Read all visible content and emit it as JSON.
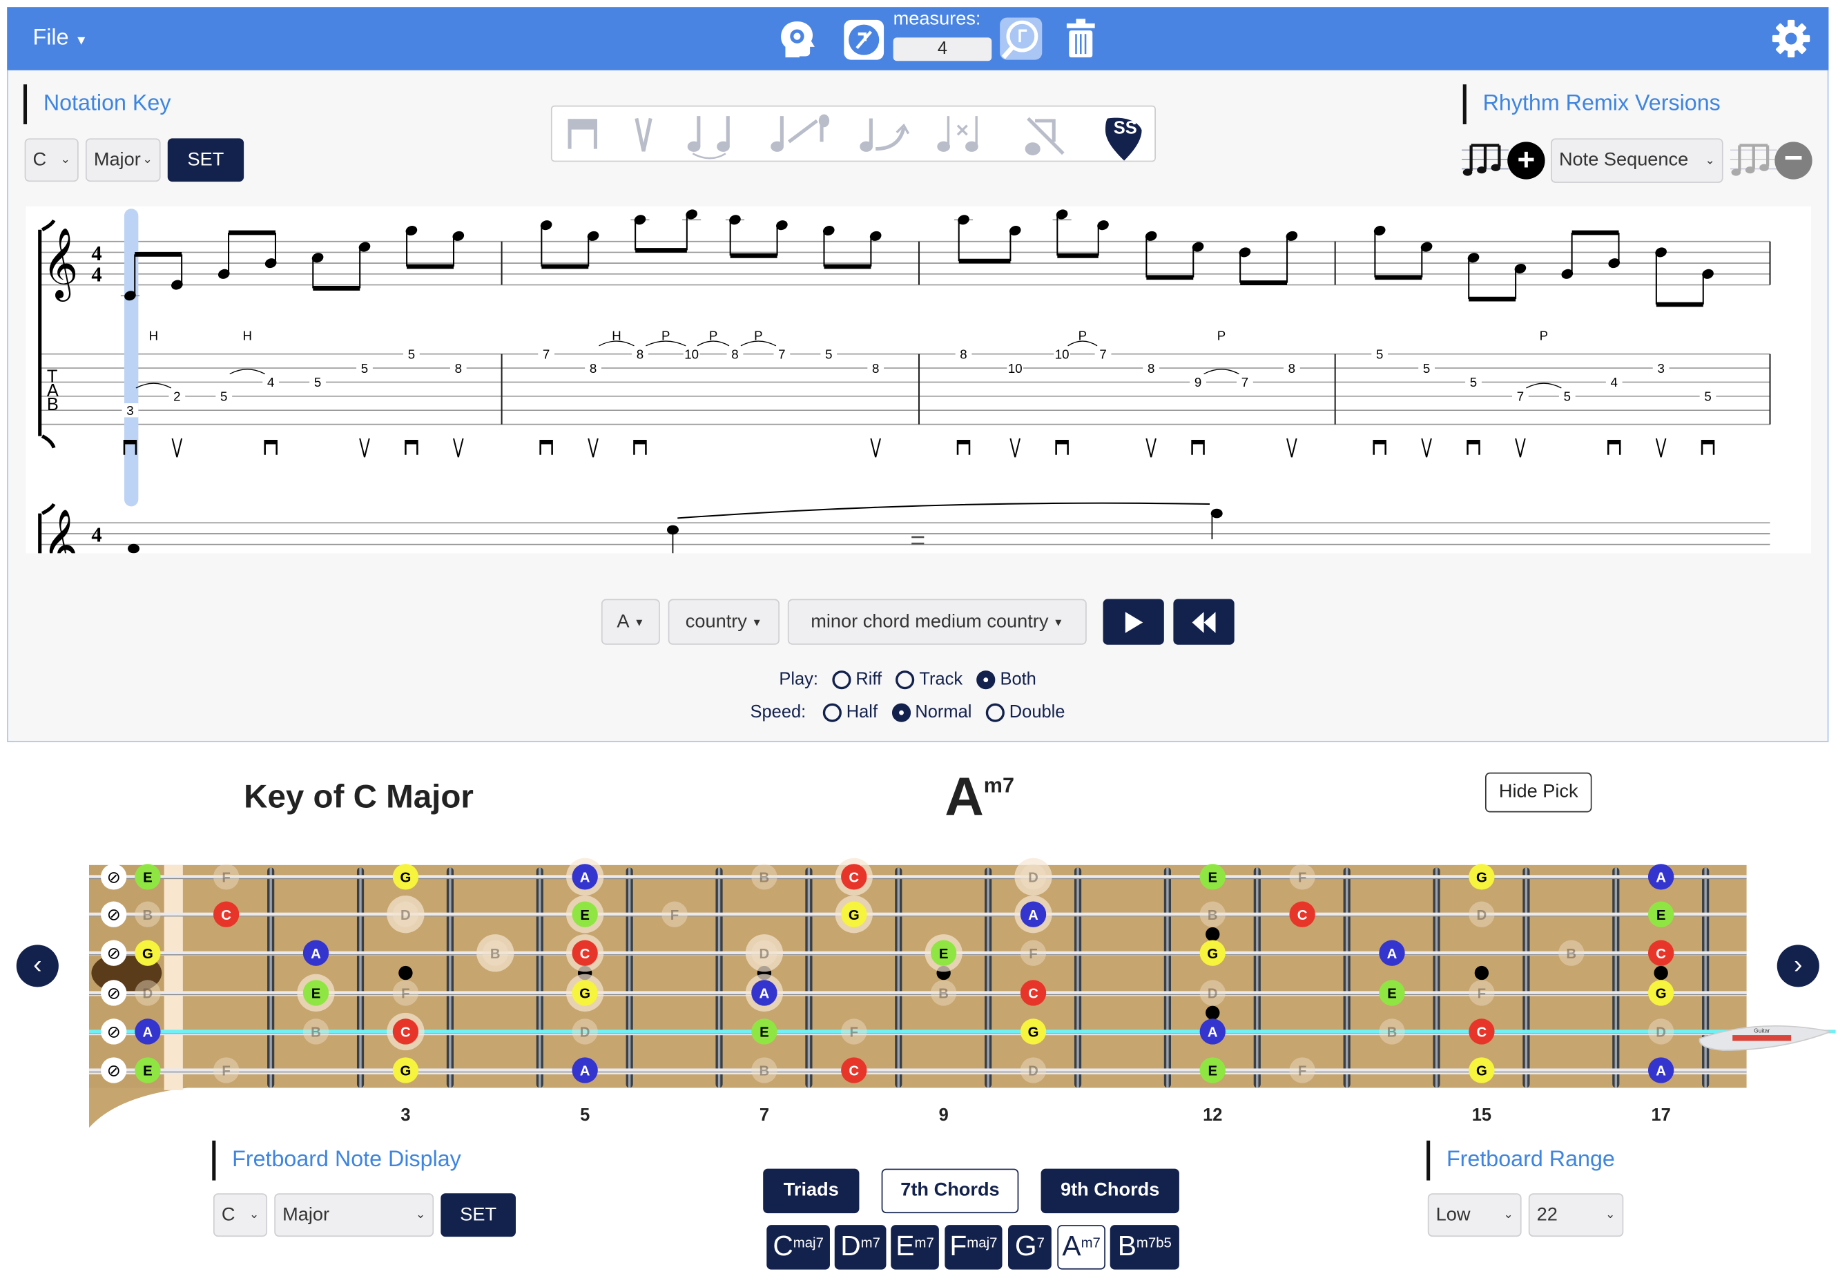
{
  "header": {
    "file_menu": "File",
    "measures_label": "measures:",
    "measures_value": "4",
    "icons": [
      "brain-gear-icon",
      "music-chart-icon",
      "music-magnify-icon",
      "trash-icon",
      "settings-gear-icon"
    ]
  },
  "notation_key": {
    "title": "Notation Key",
    "key": "C",
    "scale": "Major",
    "set_label": "SET"
  },
  "notation_toolbar": {
    "icons": [
      "downstroke-icon",
      "upstroke-icon",
      "tie-icon",
      "slide-icon",
      "bend-icon",
      "mute-icon",
      "rest-erase-icon",
      "ss-pick-icon"
    ],
    "pick_text": "SS"
  },
  "rhythm_remix": {
    "title": "Rhythm Remix Versions",
    "selected": "Note Sequence",
    "add_icon": "plus-circle-icon",
    "remove_icon": "minus-circle-icon"
  },
  "score": {
    "time_signature": [
      "4",
      "4"
    ],
    "tab_letters": [
      "T",
      "A",
      "B"
    ],
    "measures": [
      {
        "notes": [
          [
            5,
            "3",
            "D"
          ],
          [
            4,
            "2",
            "U"
          ],
          [
            4,
            "5",
            ""
          ],
          [
            3,
            "4",
            "D"
          ],
          [
            3,
            "5",
            ""
          ],
          [
            2,
            "5",
            "U"
          ],
          [
            1,
            "5",
            "D"
          ],
          [
            2,
            "8",
            "U"
          ]
        ]
      },
      {
        "notes": [
          [
            1,
            "7",
            "D"
          ],
          [
            2,
            "8",
            "U"
          ],
          [
            1,
            "8",
            "D"
          ],
          [
            1,
            "10",
            ""
          ],
          [
            1,
            "8",
            ""
          ],
          [
            1,
            "7",
            ""
          ],
          [
            1,
            "5",
            ""
          ],
          [
            2,
            "8",
            "U"
          ]
        ]
      },
      {
        "notes": [
          [
            1,
            "8",
            "D"
          ],
          [
            2,
            "10",
            "U"
          ],
          [
            1,
            "10",
            "D"
          ],
          [
            1,
            "7",
            ""
          ],
          [
            2,
            "8",
            "U"
          ],
          [
            3,
            "9",
            "D"
          ],
          [
            3,
            "7",
            ""
          ],
          [
            2,
            "8",
            "U"
          ]
        ]
      },
      {
        "notes": [
          [
            1,
            "5",
            "D"
          ],
          [
            2,
            "5",
            "U"
          ],
          [
            3,
            "5",
            "D"
          ],
          [
            4,
            "7",
            "U"
          ],
          [
            4,
            "5",
            ""
          ],
          [
            3,
            "4",
            "D"
          ],
          [
            2,
            "3",
            "U"
          ],
          [
            4,
            "5",
            "D"
          ]
        ]
      }
    ],
    "techniques": [
      [
        "H",
        0,
        1
      ],
      [
        "H",
        0,
        3
      ],
      [
        "H",
        1,
        2
      ],
      [
        "P",
        1,
        3
      ],
      [
        "P",
        1,
        4
      ],
      [
        "P",
        1,
        5
      ],
      [
        "P",
        2,
        3
      ],
      [
        "P",
        2,
        6
      ],
      [
        "P",
        3,
        4
      ]
    ],
    "drag_handle": "="
  },
  "playback": {
    "key": "A",
    "genre": "country",
    "track": "minor chord medium country",
    "play_icon": "play-icon",
    "rewind_icon": "rewind-icon",
    "play_label": "Play:",
    "play_options": [
      "Riff",
      "Track",
      "Both"
    ],
    "play_selected": "Both",
    "speed_label": "Speed:",
    "speed_options": [
      "Half",
      "Normal",
      "Double"
    ],
    "speed_selected": "Normal"
  },
  "fretboard": {
    "key_title": "Key of C Major",
    "chord_root": "A",
    "chord_quality": "m7",
    "hide_pick_label": "Hide Pick",
    "chord_tones": [
      "A",
      "C",
      "E",
      "G"
    ],
    "colors": {
      "A": "#3434cf",
      "C": "#e8352a",
      "E": "#8fe643",
      "G": "#f6f43c",
      "wood": "#c6a56f",
      "nav": "#13214d",
      "highlight_string": "#6ff0f4"
    },
    "highlight_string": 5,
    "strings": [
      {
        "open": "E",
        "notes": [
          [
            0,
            "E"
          ],
          [
            1,
            "F"
          ],
          [
            3,
            "G"
          ],
          [
            5,
            "A"
          ],
          [
            7,
            "B"
          ],
          [
            8,
            "C"
          ],
          [
            10,
            "D"
          ],
          [
            12,
            "E"
          ],
          [
            13,
            "F"
          ],
          [
            15,
            "G"
          ],
          [
            17,
            "A"
          ]
        ],
        "halo": [
          5,
          8,
          10
        ]
      },
      {
        "open": "B",
        "notes": [
          [
            0,
            "B"
          ],
          [
            1,
            "C"
          ],
          [
            3,
            "D"
          ],
          [
            5,
            "E"
          ],
          [
            6,
            "F"
          ],
          [
            8,
            "G"
          ],
          [
            10,
            "A"
          ],
          [
            12,
            "B"
          ],
          [
            13,
            "C"
          ],
          [
            15,
            "D"
          ],
          [
            17,
            "E"
          ]
        ],
        "halo": [
          3,
          5,
          8,
          10
        ]
      },
      {
        "open": "G",
        "notes": [
          [
            0,
            "G"
          ],
          [
            2,
            "A"
          ],
          [
            4,
            "B"
          ],
          [
            5,
            "C"
          ],
          [
            7,
            "D"
          ],
          [
            9,
            "E"
          ],
          [
            10,
            "F"
          ],
          [
            12,
            "G"
          ],
          [
            14,
            "A"
          ],
          [
            16,
            "B"
          ],
          [
            17,
            "C"
          ]
        ],
        "halo": [
          4,
          5,
          7,
          9
        ]
      },
      {
        "open": "D",
        "notes": [
          [
            0,
            "D"
          ],
          [
            2,
            "E"
          ],
          [
            3,
            "F"
          ],
          [
            5,
            "G"
          ],
          [
            7,
            "A"
          ],
          [
            9,
            "B"
          ],
          [
            10,
            "C"
          ],
          [
            12,
            "D"
          ],
          [
            14,
            "E"
          ],
          [
            15,
            "F"
          ],
          [
            17,
            "G"
          ]
        ],
        "halo": [
          2,
          5,
          7
        ]
      },
      {
        "open": "A",
        "notes": [
          [
            0,
            "A"
          ],
          [
            2,
            "B"
          ],
          [
            3,
            "C"
          ],
          [
            5,
            "D"
          ],
          [
            7,
            "E"
          ],
          [
            8,
            "F"
          ],
          [
            10,
            "G"
          ],
          [
            12,
            "A"
          ],
          [
            14,
            "B"
          ],
          [
            15,
            "C"
          ],
          [
            17,
            "D"
          ]
        ],
        "halo": [
          3
        ]
      },
      {
        "open": "E",
        "notes": [
          [
            0,
            "E"
          ],
          [
            1,
            "F"
          ],
          [
            3,
            "G"
          ],
          [
            5,
            "A"
          ],
          [
            7,
            "B"
          ],
          [
            8,
            "C"
          ],
          [
            10,
            "D"
          ],
          [
            12,
            "E"
          ],
          [
            13,
            "F"
          ],
          [
            15,
            "G"
          ],
          [
            17,
            "A"
          ]
        ],
        "halo": []
      }
    ],
    "fret_labels": [
      "3",
      "5",
      "7",
      "9",
      "12",
      "15",
      "17"
    ],
    "inlays": [
      3,
      5,
      7,
      9,
      12,
      15,
      17
    ],
    "mute_icon": "eye-slash-icon",
    "pick_brand": "Guitar"
  },
  "note_display": {
    "title": "Fretboard Note Display",
    "key": "C",
    "scale": "Major",
    "set_label": "SET"
  },
  "chord_types": [
    {
      "label": "Triads",
      "active": false
    },
    {
      "label": "7th Chords",
      "active": true
    },
    {
      "label": "9th Chords",
      "active": false
    }
  ],
  "chords": [
    {
      "root": "C",
      "q": "maj7"
    },
    {
      "root": "D",
      "q": "m7"
    },
    {
      "root": "E",
      "q": "m7"
    },
    {
      "root": "F",
      "q": "maj7"
    },
    {
      "root": "G",
      "q": "7"
    },
    {
      "root": "A",
      "q": "m7",
      "active": true
    },
    {
      "root": "B",
      "q": "m7b5"
    }
  ],
  "fretboard_range": {
    "title": "Fretboard Range",
    "low": "Low",
    "high": "22"
  }
}
